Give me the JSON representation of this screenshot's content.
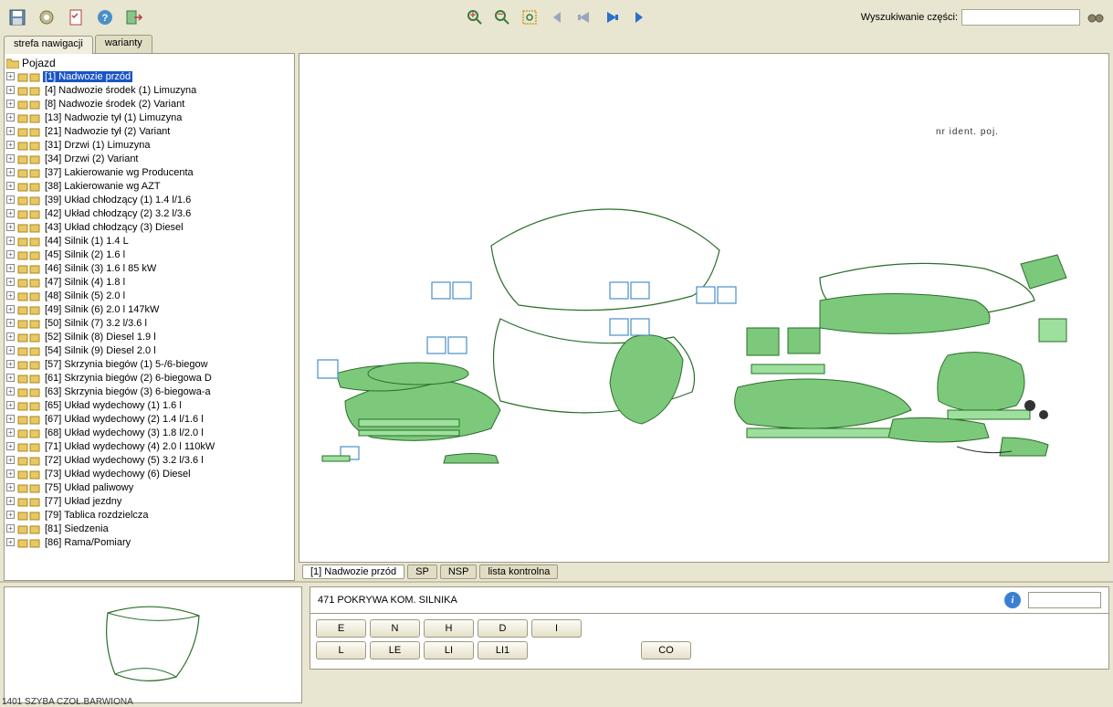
{
  "toolbar": {
    "search_label": "Wyszukiwanie części:",
    "search_value": ""
  },
  "nav_tabs": {
    "nav": "strefa nawigacji",
    "variants": "warianty"
  },
  "tree": {
    "root": "Pojazd",
    "items": [
      {
        "label": "[1] Nadwozie przód",
        "sel": true
      },
      {
        "label": "[4] Nadwozie środek (1) Limuzyna"
      },
      {
        "label": "[8] Nadwozie środek (2) Variant"
      },
      {
        "label": "[13] Nadwozie tył (1) Limuzyna"
      },
      {
        "label": "[21] Nadwozie tył (2) Variant"
      },
      {
        "label": "[31] Drzwi (1) Limuzyna"
      },
      {
        "label": "[34] Drzwi (2) Variant"
      },
      {
        "label": "[37] Lakierowanie wg Producenta"
      },
      {
        "label": "[38] Lakierowanie wg AZT"
      },
      {
        "label": "[39] Układ chłodzący (1) 1.4 l/1.6"
      },
      {
        "label": "[42] Układ chłodzący (2) 3.2 l/3.6"
      },
      {
        "label": "[43] Układ chłodzący (3) Diesel"
      },
      {
        "label": "[44] Silnik (1) 1.4 L"
      },
      {
        "label": "[45] Silnik (2) 1.6 l"
      },
      {
        "label": "[46] Silnik (3) 1.6 l 85 kW"
      },
      {
        "label": "[47] Silnik (4) 1.8 l"
      },
      {
        "label": "[48] Silnik (5) 2.0 l"
      },
      {
        "label": "[49] Silnik (6) 2.0 l 147kW"
      },
      {
        "label": "[50] Silnik (7) 3.2 l/3.6 l"
      },
      {
        "label": "[52] Silnik (8) Diesel 1.9 l"
      },
      {
        "label": "[54] Silnik (9) Diesel 2.0 l"
      },
      {
        "label": "[57] Skrzynia biegów (1) 5-/6-biegow"
      },
      {
        "label": "[61] Skrzynia biegów (2) 6-biegowa D"
      },
      {
        "label": "[63] Skrzynia biegów (3) 6-biegowa-a"
      },
      {
        "label": "[65] Układ wydechowy (1) 1.6 l"
      },
      {
        "label": "[67] Układ wydechowy (2) 1.4 l/1.6 l"
      },
      {
        "label": "[68] Układ wydechowy (3) 1.8 l/2.0 l"
      },
      {
        "label": "[71] Układ wydechowy (4) 2.0 l 110kW"
      },
      {
        "label": "[72] Układ wydechowy (5) 3.2 l/3.6 l"
      },
      {
        "label": "[73] Układ wydechowy (6) Diesel"
      },
      {
        "label": "[75] Układ paliwowy"
      },
      {
        "label": "[77] Układ jezdny"
      },
      {
        "label": "[79] Tablica rozdzielcza"
      },
      {
        "label": "[81] Siedzenia"
      },
      {
        "label": "[86] Rama/Pomiary"
      }
    ]
  },
  "canvas_tabs": {
    "t1": "[1] Nadwozie przód",
    "t2": "SP",
    "t3": "NSP",
    "t4": "lista kontrolna"
  },
  "diagram_note": "nr ident. poj.",
  "detail": {
    "title": "471 POKRYWA KOM. SILNIKA",
    "buttons_r1": [
      "E",
      "N",
      "H",
      "D",
      "I"
    ],
    "buttons_r2": [
      "L",
      "LE",
      "LI",
      "LI1"
    ],
    "co": "CO"
  },
  "status": "1401 SZYBA CZOŁ.BARWIONA"
}
